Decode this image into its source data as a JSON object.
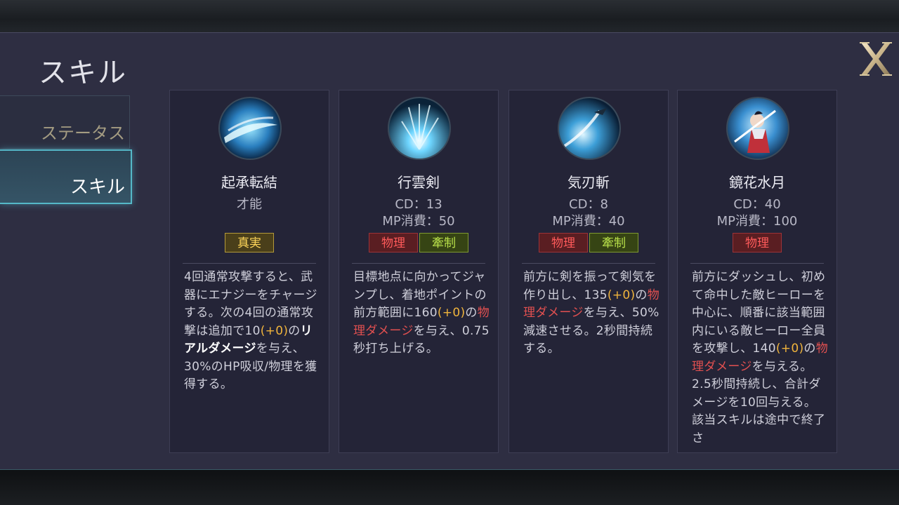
{
  "screen": {
    "title": "スキル"
  },
  "tabs": [
    {
      "label": "ステータス",
      "active": false
    },
    {
      "label": "スキル",
      "active": true
    }
  ],
  "close_icon": "close-icon",
  "colors": {
    "highlight_value": "#f0b43c",
    "physical": "#e25050",
    "true": "#ffd65a",
    "control": "#b8e04a"
  },
  "skills": [
    {
      "name": "起承転結",
      "line1": "才能",
      "line2": "",
      "tags": [
        "真実"
      ],
      "desc_parts": [
        {
          "t": "4回通常攻撃すると、武器にエナジーをチャージする。次の4回の通常攻撃は追加で10"
        },
        {
          "t": "(+0)",
          "c": "y"
        },
        {
          "t": "の"
        },
        {
          "t": "リアルダメージ",
          "c": "w"
        },
        {
          "t": "を与え、30%のHP吸収/物理を獲得する。"
        }
      ]
    },
    {
      "name": "行雲剣",
      "line1": "CD：13",
      "line2": "MP消費：50",
      "tags": [
        "物理",
        "牽制"
      ],
      "desc_parts": [
        {
          "t": "目標地点に向かってジャンプし、着地ポイントの前方範囲に160"
        },
        {
          "t": "(+0)",
          "c": "y"
        },
        {
          "t": "の"
        },
        {
          "t": "物理ダメージ",
          "c": "r"
        },
        {
          "t": "を与え、0.75秒打ち上げる。"
        }
      ]
    },
    {
      "name": "気刃斬",
      "line1": "CD：8",
      "line2": "MP消費：40",
      "tags": [
        "物理",
        "牽制"
      ],
      "desc_parts": [
        {
          "t": "前方に剣を振って剣気を作り出し、135"
        },
        {
          "t": "(+0)",
          "c": "y"
        },
        {
          "t": "の"
        },
        {
          "t": "物理ダメージ",
          "c": "r"
        },
        {
          "t": "を与え、50%減速させる。2秒間持続する。"
        }
      ]
    },
    {
      "name": "鏡花水月",
      "line1": "CD：40",
      "line2": "MP消費：100",
      "tags": [
        "物理"
      ],
      "desc_parts": [
        {
          "t": "前方にダッシュし、初めて命中した敵ヒーローを中心に、順番に該当範囲内にいる敵ヒーロー全員を攻撃し、140"
        },
        {
          "t": "(+0)",
          "c": "y"
        },
        {
          "t": "の"
        },
        {
          "t": "物理ダメージ",
          "c": "r"
        },
        {
          "t": "を与える。2.5秒間持続し、合計ダメージを10回与える。該当スキルは途中で終了さ"
        }
      ]
    }
  ]
}
